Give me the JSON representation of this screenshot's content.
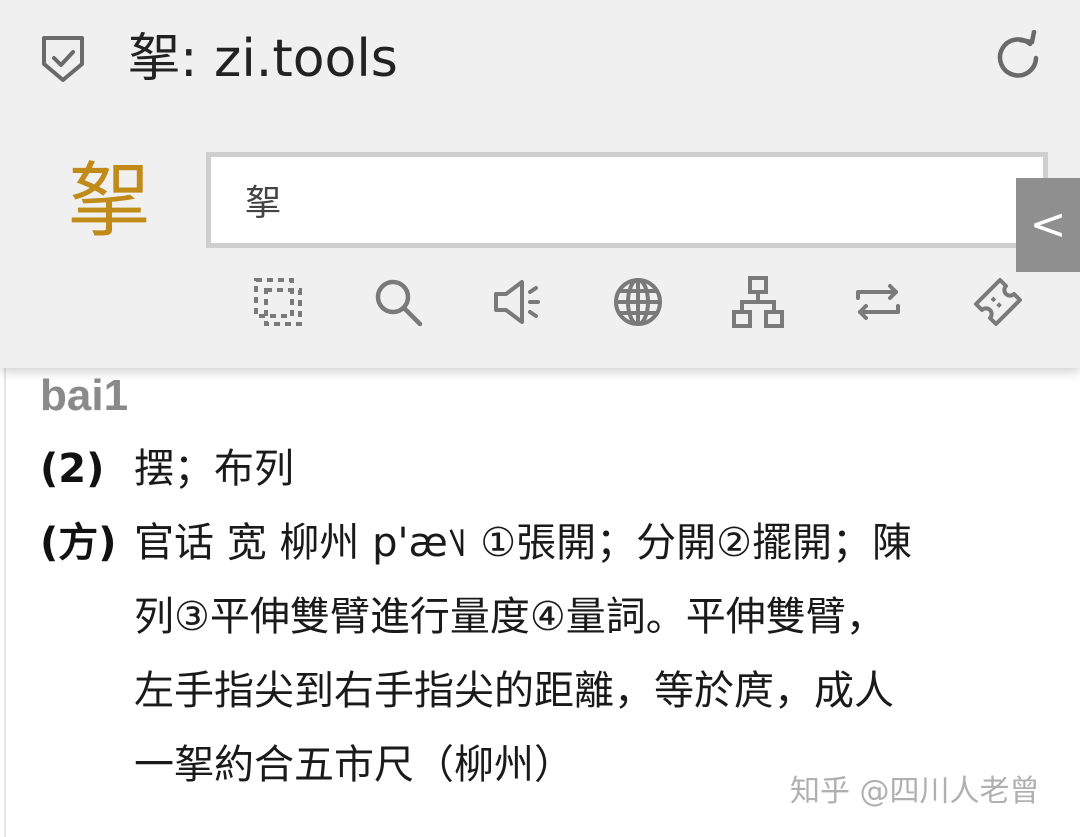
{
  "header": {
    "title": "挐: zi.tools",
    "shield_icon": "shield-check-icon",
    "reload_icon": "reload-icon"
  },
  "search": {
    "character": "挐",
    "value": "挐",
    "collapse_label": "<"
  },
  "toolbar": {
    "icons": [
      "select-icon",
      "search-icon",
      "speaker-icon",
      "globe-icon",
      "hierarchy-icon",
      "repeat-icon",
      "ticket-icon"
    ]
  },
  "content": {
    "pinyin": "bai1",
    "entries": [
      {
        "label": "(2)",
        "lines": [
          "摆；布列"
        ]
      },
      {
        "label": "(方)",
        "lines": [
          "官话 宽 柳州 p'æ˥˩ ①張開；分開②擺開；陳",
          "列③平伸雙臂進行量度④量詞。平伸雙臂，",
          "左手指尖到右手指尖的距離，等於庹，成人",
          "一挐約合五市尺（柳州）"
        ]
      }
    ]
  },
  "watermark": "知乎 @四川人老曾",
  "colors": {
    "accent": "#c18b1a",
    "chrome_bg": "#f0f0f0",
    "collapse_tab_bg": "#8f8f8f",
    "icon_gray": "#7a7a7a"
  }
}
